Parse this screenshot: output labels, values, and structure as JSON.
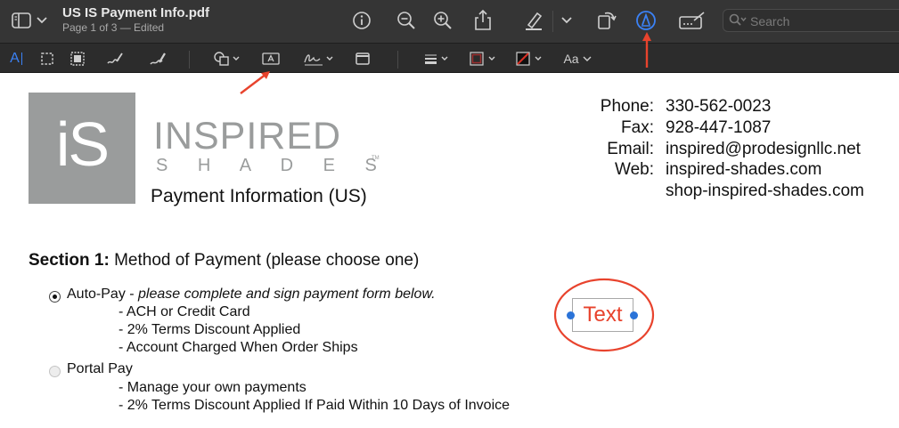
{
  "window": {
    "title": "US IS Payment Info.pdf",
    "subtitle": "Page 1 of 3 — Edited"
  },
  "toolbar": {
    "search_placeholder": "Search",
    "accent_color": "#3b82f6",
    "icons": [
      "sidebar-icon",
      "chevron-down-icon",
      "info-icon",
      "zoom-out-icon",
      "zoom-in-icon",
      "share-icon",
      "highlight-pen-icon",
      "chevron-down-icon",
      "rotate-icon",
      "markup-icon",
      "form-fill-icon",
      "search-icon"
    ]
  },
  "markup_toolbar": {
    "text_cursor_glyph": "A",
    "font_button": "Aa",
    "icons": [
      "text-selection-icon",
      "rect-selection-icon",
      "smart-lasso-icon",
      "sketch-icon",
      "draw-icon",
      "shapes-icon",
      "text-box-icon",
      "signature-icon",
      "note-icon",
      "line-style-icon",
      "border-color-icon",
      "fill-color-icon",
      "text-style-icon"
    ]
  },
  "annotation_color": "#e8432d",
  "document": {
    "logo": {
      "mark": "iS",
      "word1": "INSPIRED",
      "word2": "S H A D E S",
      "tm": "TM"
    },
    "heading": "Payment Information (US)",
    "contact": [
      {
        "label": "Phone:",
        "value": "330-562-0023"
      },
      {
        "label": "Fax:",
        "value": "928-447-1087"
      },
      {
        "label": "Email:",
        "value": "inspired@prodesignllc.net"
      },
      {
        "label": "Web:",
        "value": "inspired-shades.com"
      },
      {
        "label": "",
        "value": "shop-inspired-shades.com"
      }
    ],
    "section_title_bold": "Section 1:",
    "section_title_rest": " Method of Payment (please choose one)",
    "options": [
      {
        "label": "Auto-Pay",
        "label_suffix": " - ",
        "note": "please complete and sign payment form below.",
        "selected": true,
        "bullets": [
          "- ACH or Credit Card",
          "- 2% Terms Discount Applied",
          "- Account Charged When Order Ships"
        ]
      },
      {
        "label": "Portal Pay",
        "label_suffix": "",
        "note": "",
        "selected": false,
        "bullets": [
          "- Manage your own payments",
          "- 2% Terms Discount Applied If Paid Within 10 Days of Invoice"
        ]
      }
    ],
    "text_box": "Text"
  }
}
